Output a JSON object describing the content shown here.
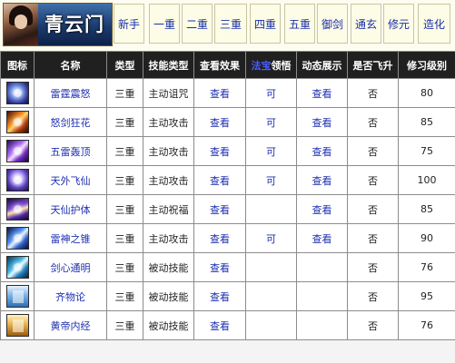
{
  "header": {
    "sect_title": "青云门",
    "tabs": [
      {
        "label": "新手"
      },
      {
        "label": "一重"
      },
      {
        "label": "二重"
      },
      {
        "label": "三重"
      },
      {
        "label": "四重"
      },
      {
        "label": "五重"
      },
      {
        "label": "御剑"
      },
      {
        "label": "通玄"
      },
      {
        "label": "修元"
      },
      {
        "label": "造化"
      }
    ]
  },
  "table": {
    "columns": {
      "icon": "图标",
      "name": "名称",
      "type": "类型",
      "skill_type": "技能类型",
      "effect": "查看效果",
      "comprehend_prefix": "法宝",
      "comprehend_suffix": "领悟",
      "animation": "动态展示",
      "ascend": "是否飞升",
      "level": "修习级别"
    },
    "rows": [
      {
        "icon": "thunder-icon",
        "name": "雷霆震怒",
        "type": "三重",
        "skill_type": "主动诅咒",
        "effect": "查看",
        "comprehend": "可",
        "animation": "查看",
        "ascend": "否",
        "level": "80"
      },
      {
        "icon": "sword-icon",
        "name": "怒剑狂花",
        "type": "三重",
        "skill_type": "主动攻击",
        "effect": "查看",
        "comprehend": "可",
        "animation": "查看",
        "ascend": "否",
        "level": "85"
      },
      {
        "icon": "lightning-icon",
        "name": "五雷轰顶",
        "type": "三重",
        "skill_type": "主动攻击",
        "effect": "查看",
        "comprehend": "可",
        "animation": "查看",
        "ascend": "否",
        "level": "75"
      },
      {
        "icon": "flying-immortal-icon",
        "name": "天外飞仙",
        "type": "三重",
        "skill_type": "主动攻击",
        "effect": "查看",
        "comprehend": "可",
        "animation": "查看",
        "ascend": "否",
        "level": "100"
      },
      {
        "icon": "guardian-icon",
        "name": "天仙护体",
        "type": "三重",
        "skill_type": "主动祝福",
        "effect": "查看",
        "comprehend": "",
        "animation": "查看",
        "ascend": "否",
        "level": "85"
      },
      {
        "icon": "thunder-spear-icon",
        "name": "雷神之锥",
        "type": "三重",
        "skill_type": "主动攻击",
        "effect": "查看",
        "comprehend": "可",
        "animation": "查看",
        "ascend": "否",
        "level": "90"
      },
      {
        "icon": "mind-sword-icon",
        "name": "剑心通明",
        "type": "三重",
        "skill_type": "被动技能",
        "effect": "查看",
        "comprehend": "",
        "animation": "",
        "ascend": "否",
        "level": "76"
      },
      {
        "icon": "book-icon",
        "name": "齐物论",
        "type": "三重",
        "skill_type": "被动技能",
        "effect": "查看",
        "comprehend": "",
        "animation": "",
        "ascend": "否",
        "level": "95"
      },
      {
        "icon": "scroll-icon",
        "name": "黄帝内经",
        "type": "三重",
        "skill_type": "被动技能",
        "effect": "查看",
        "comprehend": "",
        "animation": "",
        "ascend": "否",
        "level": "76"
      }
    ]
  }
}
